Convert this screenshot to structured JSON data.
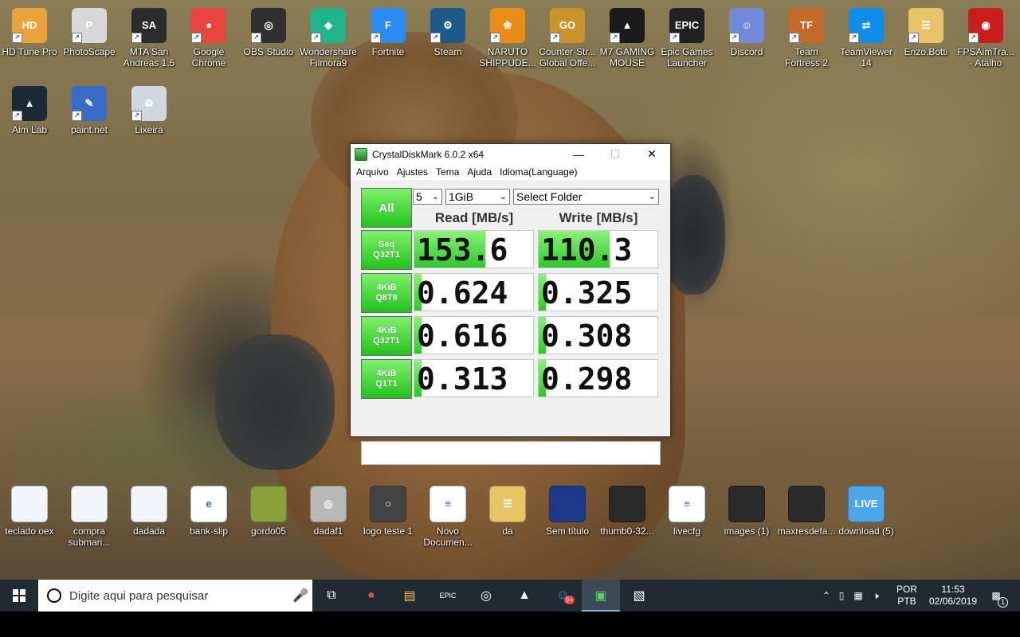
{
  "desktop": {
    "icons": [
      {
        "label": "HD Tune Pro",
        "glyph": "HD",
        "color": "#e8a33c"
      },
      {
        "label": "PhotoScape",
        "glyph": "P",
        "color": "#d8d8d8"
      },
      {
        "label": "MTA San Andreas 1.5",
        "glyph": "SA",
        "color": "#2c2c2c"
      },
      {
        "label": "Google Chrome",
        "glyph": "●",
        "color": "#e8453c"
      },
      {
        "label": "OBS Studio",
        "glyph": "◎",
        "color": "#303030"
      },
      {
        "label": "Wondershare Filmora9",
        "glyph": "◆",
        "color": "#1fb48a"
      },
      {
        "label": "Fortnite",
        "glyph": "F",
        "color": "#2e8cf0"
      },
      {
        "label": "Steam",
        "glyph": "⚙",
        "color": "#1b5a8c"
      },
      {
        "label": "NARUTO SHIPPUDE...",
        "glyph": "❀",
        "color": "#e88d1a"
      },
      {
        "label": "Counter-Str... Global Offe...",
        "glyph": "GO",
        "color": "#c9922a"
      },
      {
        "label": "M7 GAMING MOUSE",
        "glyph": "▲",
        "color": "#1b1b1b"
      },
      {
        "label": "Epic Games Launcher",
        "glyph": "EPIC",
        "color": "#222"
      },
      {
        "label": "Discord",
        "glyph": "☺",
        "color": "#7289da"
      },
      {
        "label": "Team Fortress 2",
        "glyph": "TF",
        "color": "#c26a2a"
      },
      {
        "label": "TeamViewer 14",
        "glyph": "⇄",
        "color": "#0e8ee9"
      },
      {
        "label": "Enzo.Botti",
        "glyph": "☰",
        "color": "#e8c468"
      },
      {
        "label": "FPSAimTra... - Atalho",
        "glyph": "◉",
        "color": "#c91e1e"
      },
      {
        "label": "Aim Lab",
        "glyph": "▲",
        "color": "#1c2a36"
      },
      {
        "label": "paint.net",
        "glyph": "✎",
        "color": "#3a6bc9"
      },
      {
        "label": "Lixeira",
        "glyph": "♻",
        "color": "#cfd8df"
      }
    ],
    "bottom_icons": [
      {
        "label": "teclado oex",
        "glyph": "",
        "color": "#f2f6fb"
      },
      {
        "label": "compra submari...",
        "glyph": "",
        "color": "#f2f6fb"
      },
      {
        "label": "dadada",
        "glyph": "",
        "color": "#f2f6fb"
      },
      {
        "label": "bank-slip",
        "glyph": "e",
        "color": "#ffffff"
      },
      {
        "label": "gordo05",
        "glyph": "",
        "color": "#8aa03a"
      },
      {
        "label": "dadaf1",
        "glyph": "◎",
        "color": "#b9b9b9"
      },
      {
        "label": "logo teste 1",
        "glyph": "○",
        "color": "#444"
      },
      {
        "label": "Novo Documen...",
        "glyph": "≡",
        "color": "#ffffff"
      },
      {
        "label": "da",
        "glyph": "☰",
        "color": "#e8c468"
      },
      {
        "label": "Sem título",
        "glyph": "",
        "color": "#1f3a8a"
      },
      {
        "label": "thumb0-32...",
        "glyph": "",
        "color": "#2a2a2a"
      },
      {
        "label": "livecfg",
        "glyph": "≡",
        "color": "#ffffff"
      },
      {
        "label": "images (1)",
        "glyph": "",
        "color": "#2a2a2a"
      },
      {
        "label": "maxresdefa...",
        "glyph": "",
        "color": "#2a2a2a"
      },
      {
        "label": "download (5)",
        "glyph": "LIVE",
        "color": "#4aa8e8"
      }
    ]
  },
  "cdm": {
    "title": "CrystalDiskMark 6.0.2 x64",
    "controls": {
      "min": "—",
      "max": "☐",
      "close": "✕"
    },
    "menu": [
      "Arquivo",
      "Ajustes",
      "Tema",
      "Ajuda",
      "Idioma(Language)"
    ],
    "all_label": "All",
    "count": "5",
    "size": "1GiB",
    "folder": "Select Folder",
    "read_header": "Read [MB/s]",
    "write_header": "Write [MB/s]",
    "rows": [
      {
        "l1": "Seq",
        "l2": "Q32T1",
        "read": "153.6",
        "write": "110.3",
        "read_fill": 0.6,
        "write_fill": 0.6
      },
      {
        "l1": "4KiB",
        "l2": "Q8T8",
        "read": "0.624",
        "write": "0.325",
        "read_fill": 0.06,
        "write_fill": 0.06
      },
      {
        "l1": "4KiB",
        "l2": "Q32T1",
        "read": "0.616",
        "write": "0.308",
        "read_fill": 0.06,
        "write_fill": 0.06
      },
      {
        "l1": "4KiB",
        "l2": "Q1T1",
        "read": "0.313",
        "write": "0.298",
        "read_fill": 0.06,
        "write_fill": 0.06
      }
    ],
    "status": ""
  },
  "taskbar": {
    "search_placeholder": "Digite aqui para pesquisar",
    "icons": [
      {
        "name": "task-view-icon",
        "glyph": "⧉"
      },
      {
        "name": "chrome-icon",
        "glyph": "●"
      },
      {
        "name": "file-explorer-icon",
        "glyph": "▤"
      },
      {
        "name": "epic-games-icon",
        "glyph": "EPIC"
      },
      {
        "name": "obs-icon",
        "glyph": "◎"
      },
      {
        "name": "m7-mouse-icon",
        "glyph": "▲"
      },
      {
        "name": "discord-icon",
        "glyph": "☺"
      },
      {
        "name": "crystaldiskmark-icon",
        "glyph": "▣"
      },
      {
        "name": "paint-icon",
        "glyph": "▧"
      }
    ],
    "discord_badge": "9+",
    "lang_top": "POR",
    "lang_bottom": "PTB",
    "time": "11:53",
    "date": "02/06/2019",
    "notif_count": "1"
  }
}
